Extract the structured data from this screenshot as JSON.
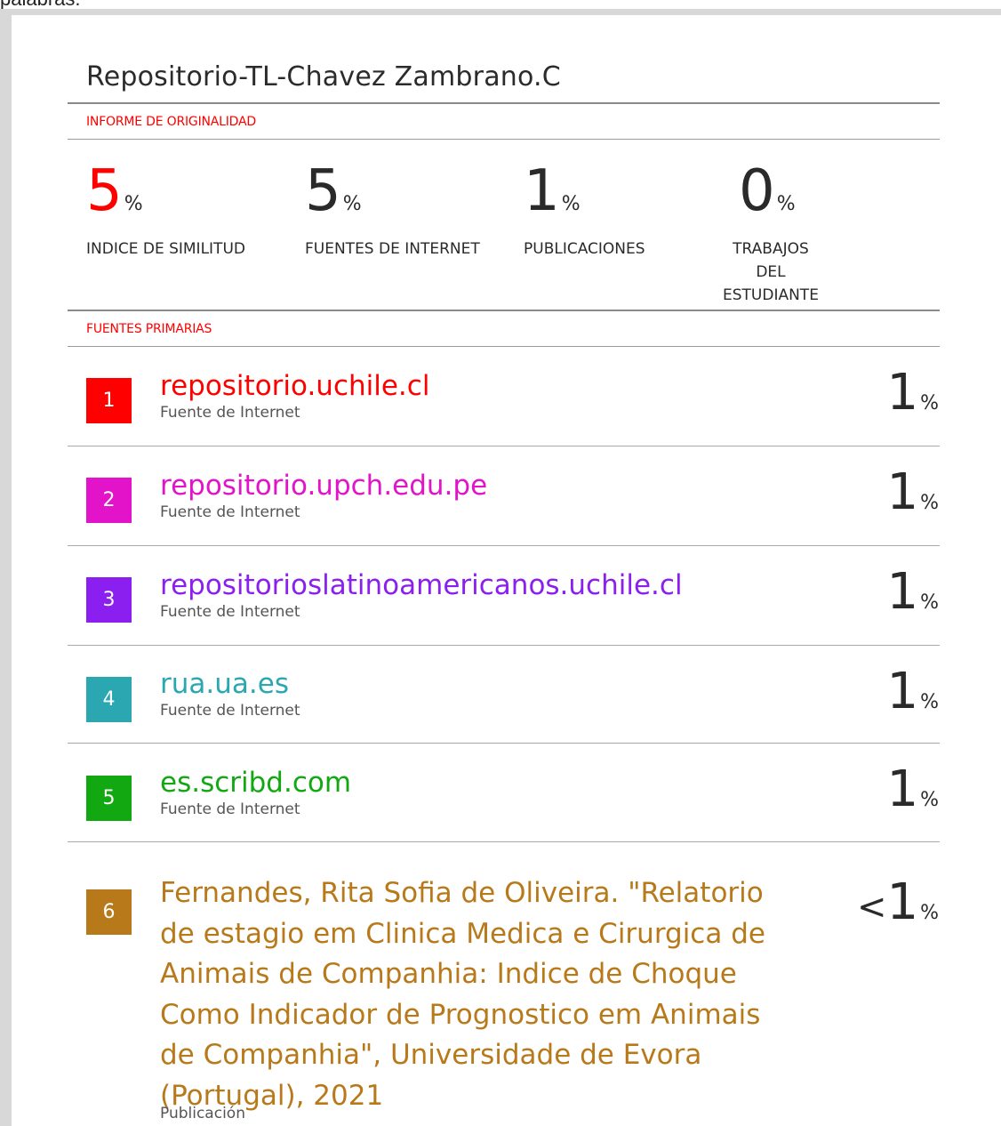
{
  "above_text": "palabras.",
  "title": "Repositorio-TL-Chavez Zambrano.C",
  "originality_label": "INFORME DE ORIGINALIDAD",
  "stats": [
    {
      "value": "5",
      "unit": "%",
      "label": "INDICE DE SIMILITUD",
      "highlight": true
    },
    {
      "value": "5",
      "unit": "%",
      "label": "FUENTES DE INTERNET",
      "highlight": false
    },
    {
      "value": "1",
      "unit": "%",
      "label": "PUBLICACIONES",
      "highlight": false
    },
    {
      "value": "0",
      "unit": "%",
      "label": "TRABAJOS DEL\nESTUDIANTE",
      "highlight": false
    }
  ],
  "primary_sources_label": "FUENTES PRIMARIAS",
  "sources": [
    {
      "num": "1",
      "name": "repositorio.uchile.cl",
      "type": "Fuente de Internet",
      "pct": "1",
      "unit": "%",
      "prefix": "",
      "color": "#ff0000"
    },
    {
      "num": "2",
      "name": "repositorio.upch.edu.pe",
      "type": "Fuente de Internet",
      "pct": "1",
      "unit": "%",
      "prefix": "",
      "color": "#e313c9"
    },
    {
      "num": "3",
      "name": "repositorioslatinoamericanos.uchile.cl",
      "type": "Fuente de Internet",
      "pct": "1",
      "unit": "%",
      "prefix": "",
      "color": "#8a1ff0"
    },
    {
      "num": "4",
      "name": "rua.ua.es",
      "type": "Fuente de Internet",
      "pct": "1",
      "unit": "%",
      "prefix": "",
      "color": "#2aa7b0"
    },
    {
      "num": "5",
      "name": "es.scribd.com",
      "type": "Fuente de Internet",
      "pct": "1",
      "unit": "%",
      "prefix": "",
      "color": "#12a812"
    },
    {
      "num": "6",
      "name": "Fernandes, Rita Sofia de Oliveira. \"Relatorio de estagio em Clinica Medica e Cirurgica de Animais de Companhia: Indice de Choque Como Indicador de Prognostico em Animais de Companhia\", Universidade de Evora (Portugal), 2021",
      "type": "Publicación",
      "pct": "1",
      "unit": "%",
      "prefix": "<",
      "color": "#b8791a"
    }
  ]
}
